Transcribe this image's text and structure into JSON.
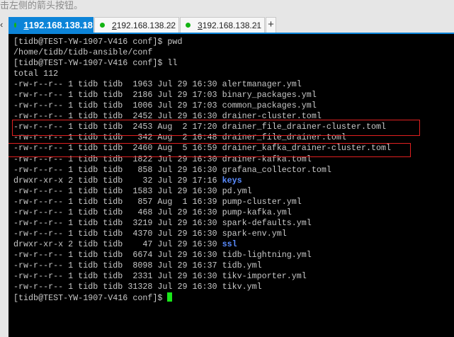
{
  "hint": "击左侧的箭头按钮。",
  "tabs": [
    {
      "num": "1",
      "host": "192.168.138.18",
      "active": true
    },
    {
      "num": "2",
      "host": "192.168.138.22"
    },
    {
      "num": "3",
      "host": "192.168.138.21"
    }
  ],
  "plus": "+",
  "close": "×",
  "nav_arrow": "‹",
  "terminal": {
    "lines": [
      "[tidb@TEST-YW-1907-V416 conf]$ pwd",
      "/home/tidb/tidb-ansible/conf",
      "[tidb@TEST-YW-1907-V416 conf]$ ll",
      "total 112"
    ],
    "entries": [
      {
        "meta": "-rw-r--r-- 1 tidb tidb  1963 Jul 29 16:30 ",
        "name": "alertmanager.yml"
      },
      {
        "meta": "-rw-r--r-- 1 tidb tidb  2186 Jul 29 17:03 ",
        "name": "binary_packages.yml"
      },
      {
        "meta": "-rw-r--r-- 1 tidb tidb  1006 Jul 29 17:03 ",
        "name": "common_packages.yml"
      },
      {
        "meta": "-rw-r--r-- 1 tidb tidb  2452 Jul 29 16:30 ",
        "name": "drainer-cluster.toml"
      },
      {
        "meta": "-rw-r--r-- 1 tidb tidb  2453 Aug  2 17:20 ",
        "name": "drainer_file_drainer-cluster.toml",
        "highlight": true
      },
      {
        "meta": "-rw-r--r-- 1 tidb tidb   342 Aug  2 16:48 ",
        "name": "drainer_file_drainer.toml"
      },
      {
        "meta": "-rw-r--r-- 1 tidb tidb  2460 Aug  5 16:59 ",
        "name": "drainer_kafka_drainer-cluster.toml",
        "highlight": true
      },
      {
        "meta": "-rw-r--r-- 1 tidb tidb  1822 Jul 29 16:30 ",
        "name": "drainer-kafka.toml"
      },
      {
        "meta": "-rw-r--r-- 1 tidb tidb   858 Jul 29 16:30 ",
        "name": "grafana_collector.toml"
      },
      {
        "meta": "drwxr-xr-x 2 tidb tidb    32 Jul 29 17:16 ",
        "name": "keys",
        "dir": true
      },
      {
        "meta": "-rw-r--r-- 1 tidb tidb  1583 Jul 29 16:30 ",
        "name": "pd.yml"
      },
      {
        "meta": "-rw-r--r-- 1 tidb tidb   857 Aug  1 16:39 ",
        "name": "pump-cluster.yml"
      },
      {
        "meta": "-rw-r--r-- 1 tidb tidb   468 Jul 29 16:30 ",
        "name": "pump-kafka.yml"
      },
      {
        "meta": "-rw-r--r-- 1 tidb tidb  3219 Jul 29 16:30 ",
        "name": "spark-defaults.yml"
      },
      {
        "meta": "-rw-r--r-- 1 tidb tidb  4370 Jul 29 16:30 ",
        "name": "spark-env.yml"
      },
      {
        "meta": "drwxr-xr-x 2 tidb tidb    47 Jul 29 16:30 ",
        "name": "ssl",
        "dir": true
      },
      {
        "meta": "-rw-r--r-- 1 tidb tidb  6674 Jul 29 16:30 ",
        "name": "tidb-lightning.yml"
      },
      {
        "meta": "-rw-r--r-- 1 tidb tidb  8098 Jul 29 16:37 ",
        "name": "tidb.yml"
      },
      {
        "meta": "-rw-r--r-- 1 tidb tidb  2331 Jul 29 16:30 ",
        "name": "tikv-importer.yml"
      },
      {
        "meta": "-rw-r--r-- 1 tidb tidb 31328 Jul 29 16:30 ",
        "name": "tikv.yml"
      }
    ],
    "prompt": "[tidb@TEST-YW-1907-V416 conf]$ "
  },
  "colors": {
    "accent": "#0c84d8",
    "highlight": "#e02020",
    "cursor": "#19e619",
    "dir": "#5a8cff"
  }
}
